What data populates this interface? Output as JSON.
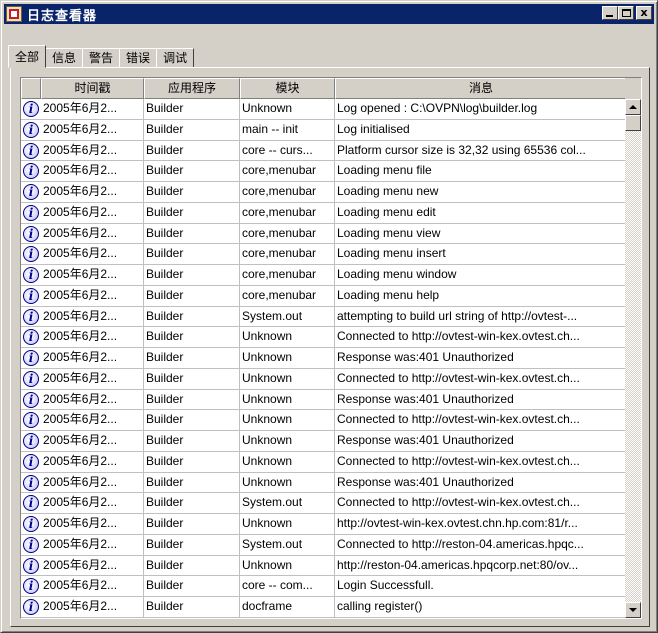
{
  "window": {
    "title": "日志查看器",
    "minimize_label": "_",
    "maximize_label": "",
    "close_label": "x"
  },
  "tabs": [
    {
      "label": "全部",
      "active": true
    },
    {
      "label": "信息",
      "active": false
    },
    {
      "label": "警告",
      "active": false
    },
    {
      "label": "错误",
      "active": false
    },
    {
      "label": "调试",
      "active": false
    }
  ],
  "table": {
    "columns": [
      "",
      "时间戳",
      "应用程序",
      "模块",
      "消息"
    ],
    "row_icon": "info-icon",
    "rows": [
      [
        "2005年6月2...",
        "Builder",
        "Unknown",
        "Log opened : C:\\OVPN\\log\\builder.log"
      ],
      [
        "2005年6月2...",
        "Builder",
        "main -- init",
        "Log initialised"
      ],
      [
        "2005年6月2...",
        "Builder",
        "core -- curs...",
        "Platform cursor size is 32,32 using 65536 col..."
      ],
      [
        "2005年6月2...",
        "Builder",
        "core,menubar",
        "Loading menu file"
      ],
      [
        "2005年6月2...",
        "Builder",
        "core,menubar",
        "Loading menu new"
      ],
      [
        "2005年6月2...",
        "Builder",
        "core,menubar",
        "Loading menu edit"
      ],
      [
        "2005年6月2...",
        "Builder",
        "core,menubar",
        "Loading menu view"
      ],
      [
        "2005年6月2...",
        "Builder",
        "core,menubar",
        "Loading menu insert"
      ],
      [
        "2005年6月2...",
        "Builder",
        "core,menubar",
        "Loading menu window"
      ],
      [
        "2005年6月2...",
        "Builder",
        "core,menubar",
        "Loading menu help"
      ],
      [
        "2005年6月2...",
        "Builder",
        "System.out",
        "attempting to build url string of http://ovtest-..."
      ],
      [
        "2005年6月2...",
        "Builder",
        "Unknown",
        "Connected to http://ovtest-win-kex.ovtest.ch..."
      ],
      [
        "2005年6月2...",
        "Builder",
        "Unknown",
        "Response was:401 Unauthorized"
      ],
      [
        "2005年6月2...",
        "Builder",
        "Unknown",
        "Connected to http://ovtest-win-kex.ovtest.ch..."
      ],
      [
        "2005年6月2...",
        "Builder",
        "Unknown",
        "Response was:401 Unauthorized"
      ],
      [
        "2005年6月2...",
        "Builder",
        "Unknown",
        "Connected to http://ovtest-win-kex.ovtest.ch..."
      ],
      [
        "2005年6月2...",
        "Builder",
        "Unknown",
        "Response was:401 Unauthorized"
      ],
      [
        "2005年6月2...",
        "Builder",
        "Unknown",
        "Connected to http://ovtest-win-kex.ovtest.ch..."
      ],
      [
        "2005年6月2...",
        "Builder",
        "Unknown",
        "Response was:401 Unauthorized"
      ],
      [
        "2005年6月2...",
        "Builder",
        "System.out",
        "Connected to http://ovtest-win-kex.ovtest.ch..."
      ],
      [
        "2005年6月2...",
        "Builder",
        "Unknown",
        "http://ovtest-win-kex.ovtest.chn.hp.com:81/r..."
      ],
      [
        "2005年6月2...",
        "Builder",
        "System.out",
        "Connected to http://reston-04.americas.hpqc..."
      ],
      [
        "2005年6月2...",
        "Builder",
        "Unknown",
        "http://reston-04.americas.hpqcorp.net:80/ov..."
      ],
      [
        "2005年6月2...",
        "Builder",
        "core -- com...",
        "Login Successfull."
      ],
      [
        "2005年6月2...",
        "Builder",
        "docframe",
        "calling register()"
      ]
    ]
  },
  "colors": {
    "titlebar": "#0a246a",
    "face": "#d4d0c8",
    "grid_bg": "#ffffff"
  }
}
